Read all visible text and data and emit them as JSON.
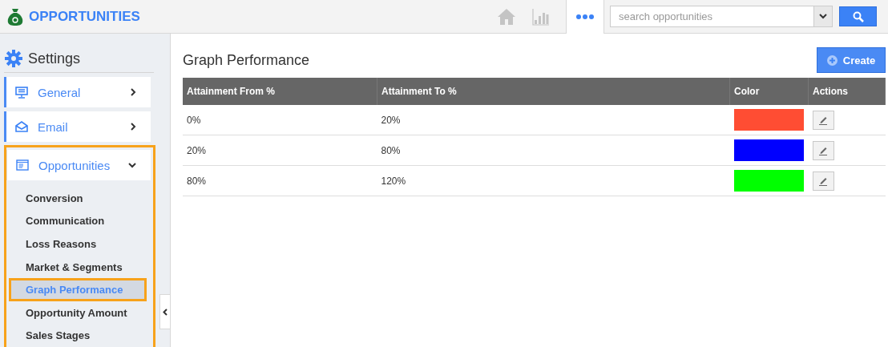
{
  "app": {
    "title": "OPPORTUNITIES"
  },
  "toolbar": {
    "search": {
      "placeholder": "search opportunities"
    }
  },
  "sidebar": {
    "title": "Settings",
    "items": [
      {
        "label": "General",
        "expanded": false
      },
      {
        "label": "Email",
        "expanded": false
      },
      {
        "label": "Opportunities",
        "expanded": true,
        "children": [
          {
            "label": "Conversion",
            "selected": false
          },
          {
            "label": "Communication",
            "selected": false
          },
          {
            "label": "Loss Reasons",
            "selected": false
          },
          {
            "label": "Market & Segments",
            "selected": false
          },
          {
            "label": "Graph Performance",
            "selected": true
          },
          {
            "label": "Opportunity Amount",
            "selected": false
          },
          {
            "label": "Sales Stages",
            "selected": false
          }
        ]
      }
    ]
  },
  "main": {
    "title": "Graph Performance",
    "create_button": "Create",
    "table": {
      "columns": [
        "Attainment From %",
        "Attainment To %",
        "Color",
        "Actions"
      ],
      "rows": [
        {
          "from": "0%",
          "to": "20%",
          "color": "#ff4d33"
        },
        {
          "from": "20%",
          "to": "80%",
          "color": "#0000ff"
        },
        {
          "from": "80%",
          "to": "120%",
          "color": "#00ff00"
        }
      ]
    }
  }
}
